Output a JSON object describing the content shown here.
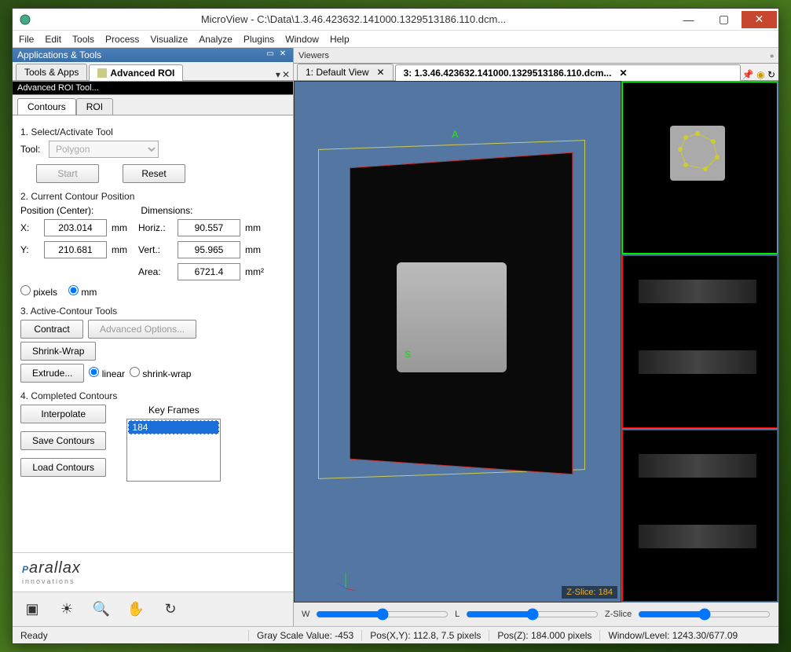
{
  "window": {
    "title": "MicroView - C:\\Data\\1.3.46.423632.141000.1329513186.110.dcm..."
  },
  "menu": [
    "File",
    "Edit",
    "Tools",
    "Process",
    "Visualize",
    "Analyze",
    "Plugins",
    "Window",
    "Help"
  ],
  "left_panel": {
    "header": "Applications & Tools",
    "tabs": {
      "tools": "Tools & Apps",
      "advroi": "Advanced ROI"
    },
    "subheader": "Advanced ROI Tool...",
    "subtabs": {
      "contours": "Contours",
      "roi": "ROI"
    },
    "sec1": {
      "title": "1. Select/Activate Tool",
      "tool_label": "Tool:",
      "tool_value": "Polygon",
      "start": "Start",
      "reset": "Reset"
    },
    "sec2": {
      "title": "2. Current Contour Position",
      "pos_label": "Position (Center):",
      "dim_label": "Dimensions:",
      "x_label": "X:",
      "x_val": "203.014",
      "y_label": "Y:",
      "y_val": "210.681",
      "h_label": "Horiz.:",
      "h_val": "90.557",
      "v_label": "Vert.:",
      "v_val": "95.965",
      "area_label": "Area:",
      "area_val": "6721.4",
      "mm": "mm",
      "mm2": "mm²",
      "unit_pixels": "pixels",
      "unit_mm": "mm"
    },
    "sec3": {
      "title": "3. Active-Contour Tools",
      "contract": "Contract",
      "advopts": "Advanced Options...",
      "shrink": "Shrink-Wrap",
      "extrude": "Extrude...",
      "linear": "linear",
      "shrinkwrap": "shrink-wrap"
    },
    "sec4": {
      "title": "4. Completed Contours",
      "interp": "Interpolate",
      "save": "Save Contours",
      "load": "Load Contours",
      "kf_title": "Key Frames",
      "kf_item": "184"
    },
    "logo": {
      "name": "Parallax",
      "sub": "innovations"
    }
  },
  "viewers": {
    "header": "Viewers",
    "tab1": "1: Default View",
    "tab2": "3: 1.3.46.423632.141000.1329513186.110.dcm...",
    "zslice": "Z-Slice: 184",
    "markers": {
      "A": "A",
      "S": "S"
    },
    "slider_w": "W",
    "slider_l": "L",
    "slider_z": "Z-Slice"
  },
  "status": {
    "ready": "Ready",
    "gray": "Gray Scale Value: -453",
    "posxy": "Pos(X,Y): 112.8, 7.5 pixels",
    "posz": "Pos(Z): 184.000 pixels",
    "wl": "Window/Level: 1243.30/677.09"
  }
}
